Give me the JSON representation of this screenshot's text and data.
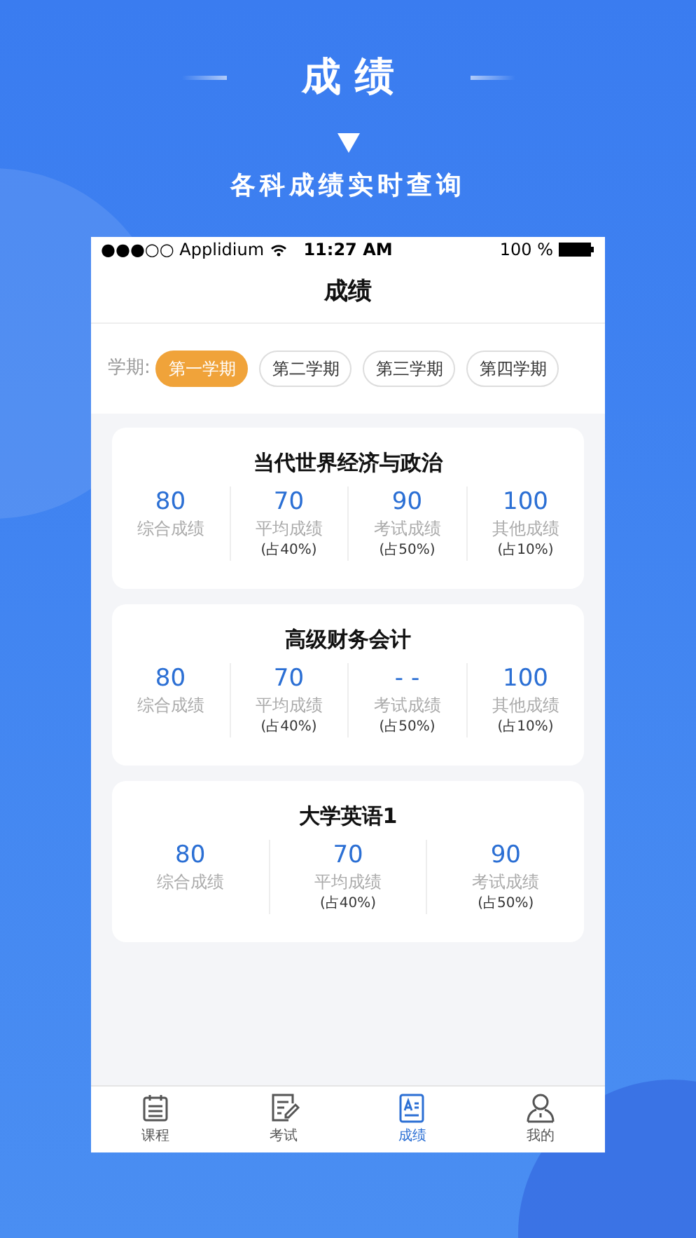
{
  "banner": {
    "title": "成绩",
    "subtitle": "各科成绩实时查询"
  },
  "status_bar": {
    "carrier": "●●●○○ Applidium",
    "time": "11:27 AM",
    "battery": "100 %"
  },
  "nav_title": "成绩",
  "semester_filter": {
    "label": "学期:",
    "options": [
      {
        "label": "第一学期",
        "selected": true
      },
      {
        "label": "第二学期",
        "selected": false
      },
      {
        "label": "第三学期",
        "selected": false
      },
      {
        "label": "第四学期",
        "selected": false
      }
    ]
  },
  "courses": [
    {
      "name": "当代世界经济与政治",
      "scores": [
        {
          "value": "80",
          "label": "综合成绩"
        },
        {
          "value": "70",
          "label": "平均成绩",
          "note": "(占40%)"
        },
        {
          "value": "90",
          "label": "考试成绩",
          "note": "(占50%)"
        },
        {
          "value": "100",
          "label": "其他成绩",
          "note": "(占10%)"
        }
      ]
    },
    {
      "name": "高级财务会计",
      "scores": [
        {
          "value": "80",
          "label": "综合成绩"
        },
        {
          "value": "70",
          "label": "平均成绩",
          "note": "(占40%)"
        },
        {
          "value": "- -",
          "label": "考试成绩",
          "note": "(占50%)"
        },
        {
          "value": "100",
          "label": "其他成绩",
          "note": "(占10%)"
        }
      ]
    },
    {
      "name": "大学英语1",
      "scores": [
        {
          "value": "80",
          "label": "综合成绩"
        },
        {
          "value": "70",
          "label": "平均成绩",
          "note": "(占40%)"
        },
        {
          "value": "90",
          "label": "考试成绩",
          "note": "(占50%)"
        }
      ]
    }
  ],
  "tab_bar": [
    {
      "kind": "calendar",
      "label": "课程",
      "selected": false
    },
    {
      "kind": "exam",
      "label": "考试",
      "selected": false
    },
    {
      "kind": "grades",
      "label": "成绩",
      "selected": true
    },
    {
      "kind": "profile",
      "label": "我的",
      "selected": false
    }
  ]
}
